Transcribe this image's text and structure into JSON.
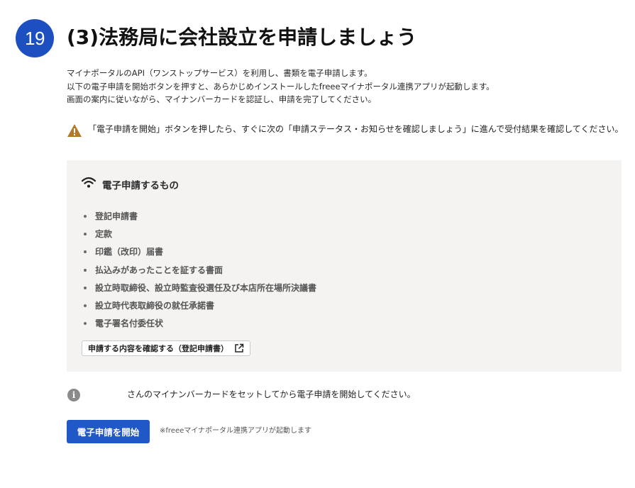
{
  "step": {
    "number": "19",
    "title": "(3)法務局に会社設立を申請しましょう"
  },
  "intro": {
    "lines": [
      "マイナポータルのAPI（ワンストップサービス）を利用し、書類を電子申請します。",
      "以下の電子申請を開始ボタンを押すと、あらかじめインストールしたfreeeマイナポータル連携アプリが起動します。",
      "画面の案内に従いながら、マイナンバーカードを認証し、申請を完了してください。"
    ]
  },
  "warning": {
    "icon": "warning-triangle-icon",
    "text": "「電子申請を開始」ボタンを押したら、すぐに次の「申請ステータス・お知らせを確認しましょう」に進んで受付結果を確認してください。"
  },
  "panel": {
    "icon": "wifi-icon",
    "title": "電子申請するもの",
    "items": [
      "登記申請書",
      "定款",
      "印鑑（改印）届書",
      "払込みがあったことを証する書面",
      "設立時取締役、設立時監査役選任及び本店所在場所決議書",
      "設立時代表取締役の就任承諾書",
      "電子署名付委任状"
    ],
    "confirm_button": "申請する内容を確認する（登記申請書）"
  },
  "info": {
    "icon": "info-icon",
    "text": "さんのマイナンバーカードをセットしてから電子申請を開始してください。"
  },
  "submit": {
    "label": "電子申請を開始",
    "note": "※freeeマイナポータル連携アプリが起動します"
  },
  "colors": {
    "accent": "#1e4fc0",
    "button": "#2158c7",
    "warning": "#b07a2a",
    "panel_bg": "#f4f3f1"
  }
}
